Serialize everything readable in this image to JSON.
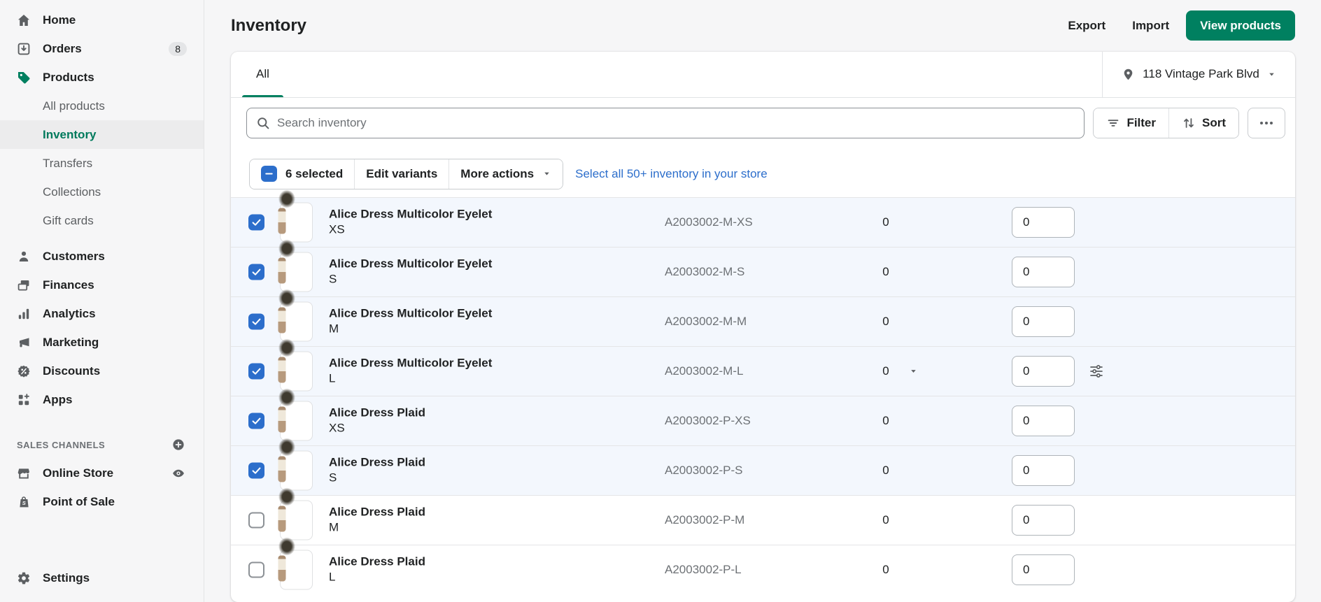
{
  "colors": {
    "primary_green": "#008060",
    "active_nav_teal": "#007a5c",
    "interactive_blue": "#2c6ecb",
    "selected_row_bg": "#f3f7fd",
    "page_bg": "#f6f6f7"
  },
  "sidebar": {
    "main": [
      {
        "label": "Home",
        "icon": "home"
      },
      {
        "label": "Orders",
        "icon": "orders",
        "badge": "8"
      },
      {
        "label": "Products",
        "icon": "products"
      }
    ],
    "products_subnav": [
      {
        "label": "All products",
        "active": false
      },
      {
        "label": "Inventory",
        "active": true
      },
      {
        "label": "Transfers",
        "active": false
      },
      {
        "label": "Collections",
        "active": false
      },
      {
        "label": "Gift cards",
        "active": false
      }
    ],
    "secondary": [
      {
        "label": "Customers",
        "icon": "customers"
      },
      {
        "label": "Finances",
        "icon": "finances"
      },
      {
        "label": "Analytics",
        "icon": "analytics"
      },
      {
        "label": "Marketing",
        "icon": "marketing"
      },
      {
        "label": "Discounts",
        "icon": "discounts"
      },
      {
        "label": "Apps",
        "icon": "apps"
      }
    ],
    "sales_channels": {
      "header": "SALES CHANNELS",
      "add_icon": "plus-circle",
      "items": [
        {
          "label": "Online Store",
          "icon": "store",
          "trailing_icon": "eye"
        },
        {
          "label": "Point of Sale",
          "icon": "pos-bag"
        }
      ]
    },
    "footer": {
      "label": "Settings",
      "icon": "gear"
    }
  },
  "header": {
    "title": "Inventory",
    "secondary_actions": [
      "Export",
      "Import"
    ],
    "primary_action": "View products"
  },
  "tabs": {
    "items": [
      {
        "label": "All",
        "active": true
      }
    ]
  },
  "location_selector": {
    "icon": "location-pin",
    "label": "118 Vintage Park Blvd",
    "caret_icon": "caret-down"
  },
  "toolbar": {
    "search": {
      "icon": "search",
      "placeholder": "Search inventory",
      "value": ""
    },
    "filter_label": "Filter",
    "filter_icon": "filter",
    "sort_label": "Sort",
    "sort_icon": "sort",
    "more_icon": "horizontal-dots"
  },
  "selection": {
    "checkbox_state": "indeterminate",
    "count_label": "6 selected",
    "action_labels": [
      "Edit variants",
      "More actions"
    ],
    "more_actions_caret": "caret-down",
    "select_all_link": "Select all 50+ inventory in your store"
  },
  "inventory_table": {
    "rows": [
      {
        "title": "Alice Dress Multicolor Eyelet",
        "variant": "XS",
        "sku": "A2003002-M-XS",
        "available": "0",
        "on_hand_input": "0",
        "checked": true,
        "has_quantity_popover": false,
        "has_adjustment_icon": false
      },
      {
        "title": "Alice Dress Multicolor Eyelet",
        "variant": "S",
        "sku": "A2003002-M-S",
        "available": "0",
        "on_hand_input": "0",
        "checked": true,
        "has_quantity_popover": false,
        "has_adjustment_icon": false
      },
      {
        "title": "Alice Dress Multicolor Eyelet",
        "variant": "M",
        "sku": "A2003002-M-M",
        "available": "0",
        "on_hand_input": "0",
        "checked": true,
        "has_quantity_popover": false,
        "has_adjustment_icon": false
      },
      {
        "title": "Alice Dress Multicolor Eyelet",
        "variant": "L",
        "sku": "A2003002-M-L",
        "available": "0",
        "on_hand_input": "0",
        "checked": true,
        "has_quantity_popover": true,
        "has_adjustment_icon": true
      },
      {
        "title": "Alice Dress Plaid",
        "variant": "XS",
        "sku": "A2003002-P-XS",
        "available": "0",
        "on_hand_input": "0",
        "checked": true,
        "has_quantity_popover": false,
        "has_adjustment_icon": false
      },
      {
        "title": "Alice Dress Plaid",
        "variant": "S",
        "sku": "A2003002-P-S",
        "available": "0",
        "on_hand_input": "0",
        "checked": true,
        "has_quantity_popover": false,
        "has_adjustment_icon": false
      },
      {
        "title": "Alice Dress Plaid",
        "variant": "M",
        "sku": "A2003002-P-M",
        "available": "0",
        "on_hand_input": "0",
        "checked": false,
        "has_quantity_popover": false,
        "has_adjustment_icon": false
      },
      {
        "title": "Alice Dress Plaid",
        "variant": "L",
        "sku": "A2003002-P-L",
        "available": "0",
        "on_hand_input": "0",
        "checked": false,
        "has_quantity_popover": false,
        "has_adjustment_icon": false
      }
    ]
  }
}
